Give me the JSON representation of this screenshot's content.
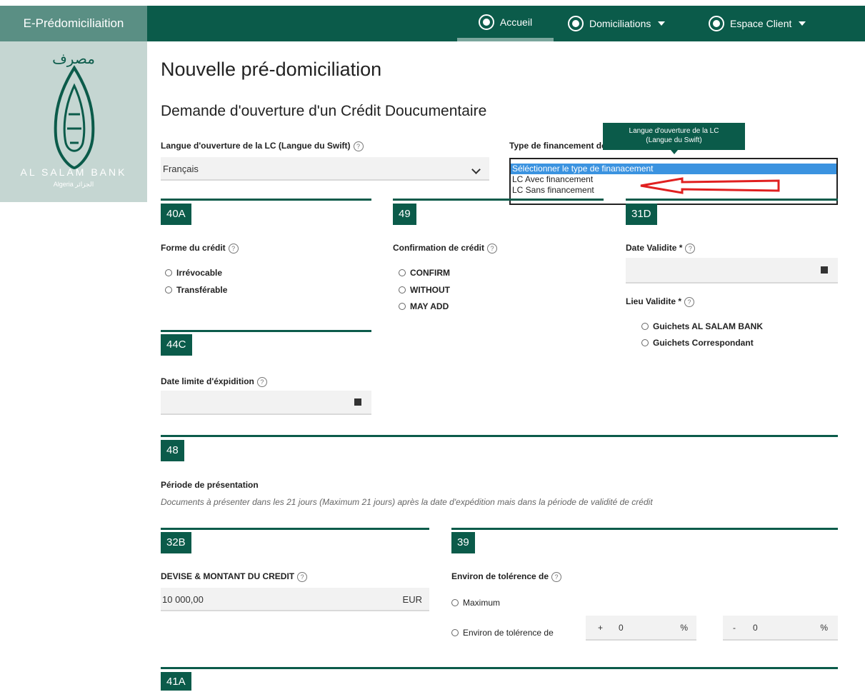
{
  "app": {
    "brand": "E-Prédomiciliaition"
  },
  "nav": {
    "home": "Accueil",
    "domiciliations": "Domiciliations",
    "client": "Espace Client"
  },
  "logo": {
    "arabic": "مصرف",
    "name": "AL SALAM BANK",
    "sub": "Algeria الجزائر"
  },
  "page": {
    "title": "Nouvelle pré-domiciliation",
    "subtitle": "Demande d'ouverture d'un Crédit Doucumentaire"
  },
  "langue": {
    "label": "Langue d'ouverture de la LC (Langue du Swift)",
    "value": "Français"
  },
  "financement": {
    "label": "Type de financement de la LC",
    "options": [
      "Séléctionner le type de finanacement",
      "LC Avec financement",
      "LC Sans financement"
    ],
    "tooltip_line1": "Langue d'ouverture de la LC",
    "tooltip_line2": "(Langue du Swift)"
  },
  "s40a": {
    "tag": "40A",
    "label": "Forme du crédit",
    "opt1": "Irrévocable",
    "opt2": "Transférable"
  },
  "s49": {
    "tag": "49",
    "label": "Confirmation de crédit",
    "opt1": "CONFIRM",
    "opt2": "WITHOUT",
    "opt3": "MAY ADD"
  },
  "s31d": {
    "tag": "31D",
    "date_label": "Date Validite *",
    "lieu_label": "Lieu Validite *",
    "opt1": "Guichets AL SALAM BANK",
    "opt2": "Guichets Correspondant"
  },
  "s44c": {
    "tag": "44C",
    "label": "Date limite d'éxpidition"
  },
  "s48": {
    "tag": "48",
    "label": "Période de présentation",
    "note": "Documents à présenter dans les 21 jours (Maximum 21 jours) après la date d'expédition mais dans la période de validité de crédit"
  },
  "s32b": {
    "tag": "32B",
    "label": "DEVISE & MONTANT DU CREDIT",
    "amount": "10 000,00",
    "currency": "EUR"
  },
  "s39": {
    "tag": "39",
    "label": "Environ de tolérence de",
    "opt1": "Maximum",
    "opt2": "Environ de tolérence de",
    "plus_sign": "+",
    "plus_value": "0",
    "minus_sign": "-",
    "minus_value": "0",
    "pct": "%"
  },
  "s41a": {
    "tag": "41A"
  },
  "colors": {
    "primary": "#0b5b4a",
    "brand_bg": "#5a8f84",
    "logo_bg": "#c5d6d2",
    "dropdown_sel": "#3b93e0",
    "annotation": "#e02020"
  }
}
